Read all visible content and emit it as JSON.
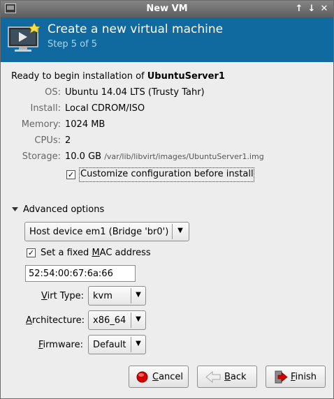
{
  "window": {
    "title": "New VM",
    "controls": [
      "↑",
      "↓",
      "✕"
    ]
  },
  "header": {
    "title": "Create a new virtual machine",
    "step": "Step 5 of 5"
  },
  "summary": {
    "ready_prefix": "Ready to begin installation of ",
    "vm_name": "UbuntuServer1",
    "rows": [
      {
        "label": "OS:",
        "value": "Ubuntu 14.04 LTS (Trusty Tahr)"
      },
      {
        "label": "Install:",
        "value": "Local CDROM/ISO"
      },
      {
        "label": "Memory:",
        "value": "1024 MB"
      },
      {
        "label": "CPUs:",
        "value": "2"
      },
      {
        "label": "Storage:",
        "value": "10.0 GB",
        "detail": "/var/lib/libvirt/images/UbuntuServer1.img"
      }
    ],
    "customize": {
      "label": "Customize configuration before install",
      "checked": true,
      "check_glyph": "✓"
    }
  },
  "advanced": {
    "expander_label": "Advanced options",
    "network_select": "Host device em1 (Bridge 'br0')",
    "fixed_mac": {
      "label_before": "Set a fixed ",
      "label_mnemonic": "M",
      "label_after": "AC address",
      "checked": true,
      "check_glyph": "✓"
    },
    "mac_value": "52:54:00:67:6a:66",
    "virt_type": {
      "label_mnemonic": "V",
      "label_rest": "irt Type:",
      "value": "kvm"
    },
    "architecture": {
      "label_mnemonic": "A",
      "label_rest": "rchitecture:",
      "value": "x86_64"
    },
    "firmware": {
      "label_mnemonic": "F",
      "label_rest": "irmware:",
      "value": "Default"
    }
  },
  "buttons": {
    "cancel": {
      "mnemonic": "C",
      "rest": "ancel"
    },
    "back": {
      "mnemonic": "B",
      "rest": "ack"
    },
    "finish": {
      "mnemonic": "F",
      "rest": "inish"
    }
  },
  "colors": {
    "banner": "#10699f",
    "step_text": "#a9d6ef",
    "cancel_icon": "#d40000"
  }
}
